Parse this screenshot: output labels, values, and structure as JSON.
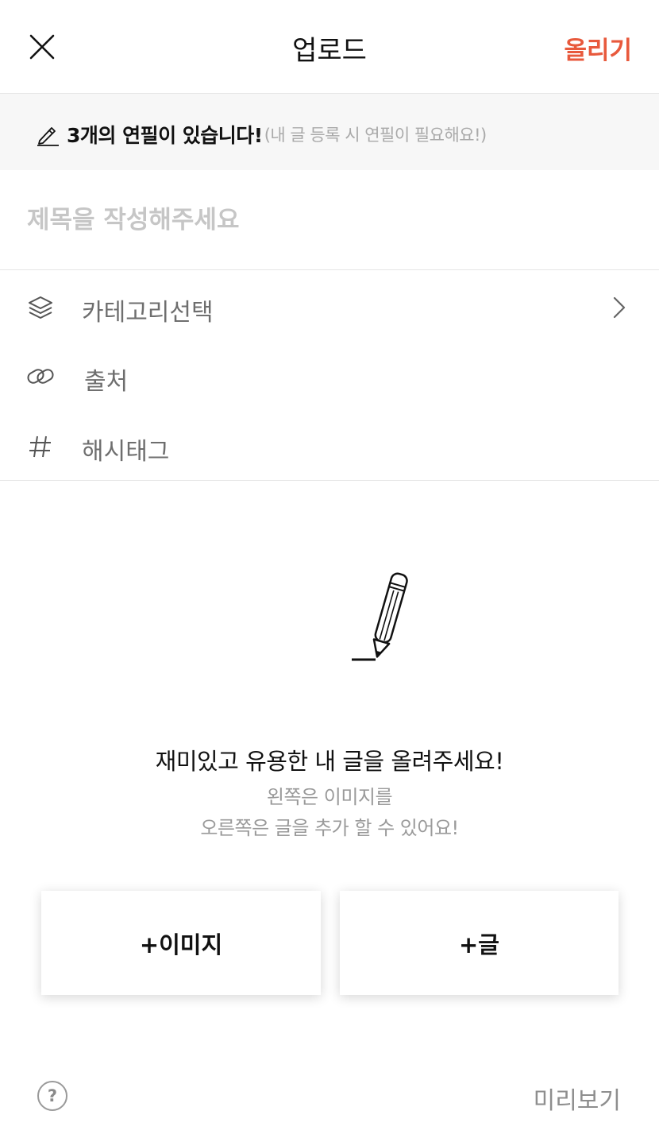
{
  "header": {
    "title": "업로드",
    "upload_label": "올리기",
    "accent_color": "#e8593c"
  },
  "notice": {
    "icon": "pencil-icon",
    "main_text": "3개의 연필이 있습니다!",
    "sub_text": "(내 글 등록 시 연필이 필요해요!)"
  },
  "title_field": {
    "placeholder": "제목을 작성해주세요",
    "value": ""
  },
  "options": [
    {
      "icon": "layers-icon",
      "label": "카테고리선택",
      "has_chevron": true
    },
    {
      "icon": "link-icon",
      "label": "출처",
      "has_chevron": false
    },
    {
      "icon": "hash-icon",
      "label": "해시태그",
      "has_chevron": false
    }
  ],
  "empty_state": {
    "illustration": "pencil-writing-icon",
    "title": "재미있고 유용한 내 글을 올려주세요!",
    "desc_line1": "왼쪽은 이미지를",
    "desc_line2": "오른쪽은 글을 추가 할 수 있어요!"
  },
  "actions": {
    "add_image": "+이미지",
    "add_text": "+글"
  },
  "footer": {
    "help_symbol": "?",
    "preview_label": "미리보기"
  }
}
